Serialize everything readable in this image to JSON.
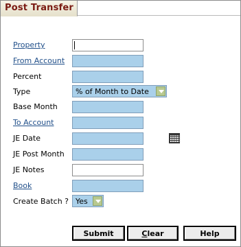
{
  "tab": {
    "title": "Post Transfer"
  },
  "form": {
    "property": {
      "label": "Property",
      "value": ""
    },
    "from_account": {
      "label": "From Account",
      "value": ""
    },
    "percent": {
      "label": "Percent",
      "value": ""
    },
    "type": {
      "label": "Type",
      "value": "% of Month to Date"
    },
    "base_month": {
      "label": "Base Month",
      "value": ""
    },
    "to_account": {
      "label": "To Account",
      "value": ""
    },
    "je_date": {
      "label": "JE Date",
      "value": ""
    },
    "je_post_month": {
      "label": "JE Post Month",
      "value": ""
    },
    "je_notes": {
      "label": "JE Notes",
      "value": ""
    },
    "book": {
      "label": "Book",
      "value": ""
    },
    "create_batch": {
      "label": "Create Batch ?",
      "value": "Yes"
    }
  },
  "buttons": {
    "submit": "Submit",
    "clear": "Clear",
    "help": "Help"
  },
  "colors": {
    "tab_text": "#7a1a12",
    "field_fill": "#aad0ea",
    "link": "#1f4e89",
    "dropdown_arrow": "#b8c98f"
  }
}
